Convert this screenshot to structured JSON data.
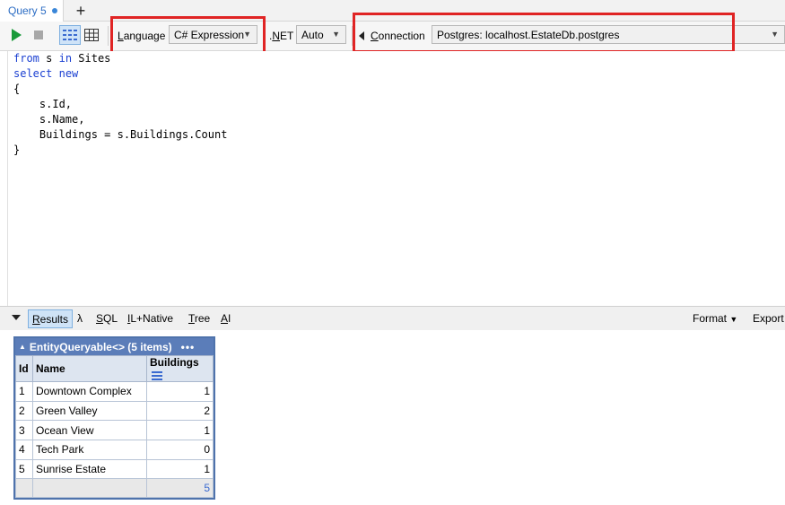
{
  "tabs": [
    {
      "label": "Query 5",
      "modified": true
    }
  ],
  "tab_add_label": "+",
  "toolbar": {
    "language_label": "Language",
    "language_underline": "L",
    "language_rest": "anguage",
    "language_value": "C# Expression",
    "dotnet_label_prefix": ".",
    "dotnet_label_underline": "N",
    "dotnet_label_rest": "ET",
    "dotnet_value": "Auto",
    "connection_underline": "C",
    "connection_rest": "onnection",
    "connection_value": "Postgres: localhost.EstateDb.postgres"
  },
  "editor": {
    "lines": [
      [
        {
          "t": "from",
          "kw": true
        },
        {
          "t": " s ",
          "kw": false
        },
        {
          "t": "in",
          "kw": true
        },
        {
          "t": " Sites",
          "kw": false
        }
      ],
      [
        {
          "t": "select",
          "kw": true
        },
        {
          "t": " ",
          "kw": false
        },
        {
          "t": "new",
          "kw": true
        }
      ],
      [
        {
          "t": "{",
          "kw": false
        }
      ],
      [
        {
          "t": "    s.Id,",
          "kw": false
        }
      ],
      [
        {
          "t": "    s.Name,",
          "kw": false
        }
      ],
      [
        {
          "t": "    Buildings = s.Buildings.Count",
          "kw": false
        }
      ],
      [
        {
          "t": "}",
          "kw": false
        }
      ]
    ]
  },
  "results_bar": {
    "results_u": "R",
    "results_rest": "esults",
    "lambda": "λ",
    "sql_u": "S",
    "sql_rest": "QL",
    "il_u": "I",
    "il_rest": "L+Native",
    "tree_u": "T",
    "tree_rest": "ree",
    "ai_u": "A",
    "ai_rest": "I",
    "format_label": "Format",
    "export_label": "Export"
  },
  "result_table": {
    "title": "EntityQueryable<> (5 items)",
    "menu": "•••",
    "columns": [
      "Id",
      "Name",
      "Buildings"
    ],
    "rows": [
      [
        "1",
        "Downtown Complex",
        "1"
      ],
      [
        "2",
        "Green Valley",
        "2"
      ],
      [
        "3",
        "Ocean View",
        "1"
      ],
      [
        "4",
        "Tech Park",
        "0"
      ],
      [
        "5",
        "Sunrise Estate",
        "1"
      ]
    ],
    "total": "5"
  },
  "colors": {
    "highlight_box": "#e02424",
    "table_header": "#5b7db9",
    "keyword": "#1a3fd1",
    "run": "#1a9a3a"
  }
}
